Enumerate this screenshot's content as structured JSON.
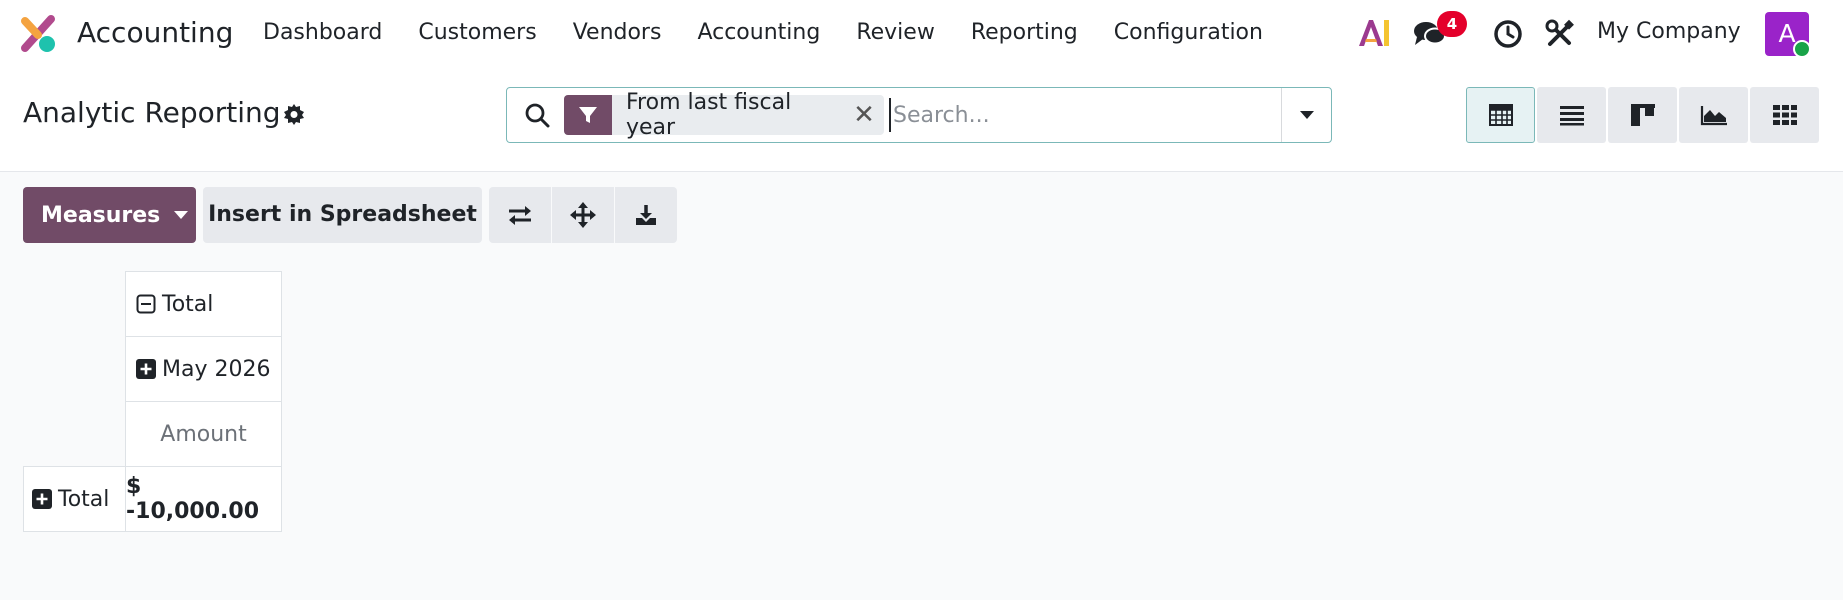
{
  "navbar": {
    "app_name": "Accounting",
    "menu": [
      "Dashboard",
      "Customers",
      "Vendors",
      "Accounting",
      "Review",
      "Reporting",
      "Configuration"
    ],
    "chat_badge": "4",
    "company": "My Company",
    "avatar_letter": "A",
    "icons": [
      "accounting-logo-icon",
      "ai-icon",
      "chat-icon",
      "clock-icon",
      "tools-icon"
    ]
  },
  "control_panel": {
    "title": "Analytic Reporting",
    "search": {
      "facet_label": "From last fiscal year",
      "placeholder": "Search..."
    },
    "views": [
      "pivot",
      "list",
      "kanban",
      "graph",
      "grid"
    ],
    "active_view": "pivot"
  },
  "toolbar": {
    "measures_label": "Measures",
    "insert_label": "Insert in Spreadsheet"
  },
  "pivot": {
    "col_header_total": "Total",
    "col_header_group": "May 2026",
    "measure_header": "Amount",
    "row_header_total": "Total",
    "total_value": "$ -10,000.00"
  },
  "colors": {
    "brand": "#714b67",
    "accent": "#7bb8b8",
    "badge": "#e4002b",
    "avatar": "#9a23c9",
    "presence": "#19a348"
  }
}
